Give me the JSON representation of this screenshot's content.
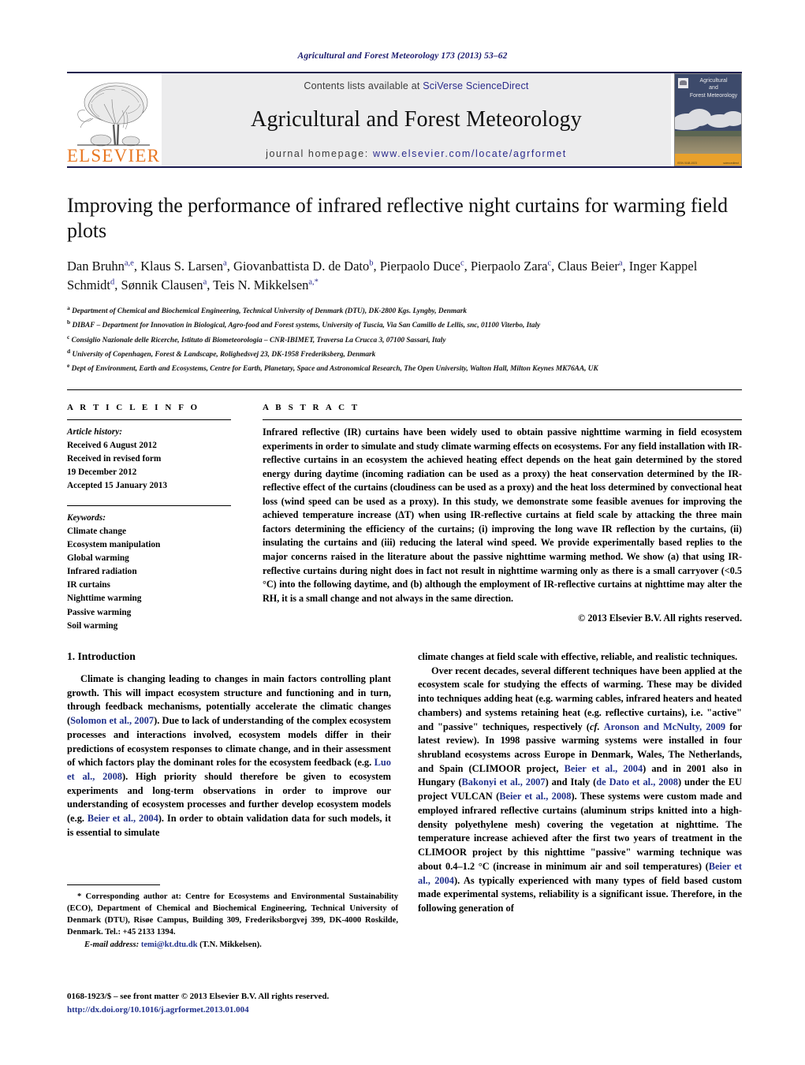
{
  "running_head": "Agricultural and Forest Meteorology 173 (2013) 53–62",
  "masthead": {
    "publisher_name": "ELSEVIER",
    "contents_prefix": "Contents lists available at ",
    "contents_link": "SciVerse ScienceDirect",
    "journal_title": "Agricultural and Forest Meteorology",
    "homepage_prefix": "journal homepage: ",
    "homepage_url": "www.elsevier.com/locate/agrformet",
    "cover_title": "Agricultural\nand\nForest Meteorology",
    "cover_bottom_left": "ISSN 0168-1923\nVol. 173",
    "cover_bottom_right": "Available online at\nwww.sciencedirect.com",
    "accent_orange": "#e87722",
    "link_blue": "#2a2a8c"
  },
  "article": {
    "title": "Improving the performance of infrared reflective night curtains for warming field plots",
    "authors_html": "Dan Bruhn<sup>a,e</sup>, Klaus S. Larsen<sup>a</sup>, Giovanbattista D. de Dato<sup>b</sup>, Pierpaolo Duce<sup>c</sup>, Pierpaolo Zara<sup>c</sup>, Claus Beier<sup>a</sup>, Inger Kappel Schmidt<sup>d</sup>, Sønnik Clausen<sup>a</sup>, Teis N. Mikkelsen<sup>a,*</sup>",
    "affiliations": [
      {
        "marker": "a",
        "text": "Department of Chemical and Biochemical Engineering, Technical University of Denmark (DTU), DK-2800 Kgs. Lyngby, Denmark"
      },
      {
        "marker": "b",
        "text": "DIBAF – Department for Innovation in Biological, Agro-food and Forest systems, University of Tuscia, Via San Camillo de Lellis, snc, 01100 Viterbo, Italy"
      },
      {
        "marker": "c",
        "text": "Consiglio Nazionale delle Ricerche, Istituto di Biometeorologia – CNR-IBIMET, Traversa La Crucca 3, 07100 Sassari, Italy"
      },
      {
        "marker": "d",
        "text": "University of Copenhagen, Forest & Landscape, Rolighedsvej 23, DK-1958 Frederiksberg, Denmark"
      },
      {
        "marker": "e",
        "text": "Dept of Environment, Earth and Ecosystems, Centre for Earth, Planetary, Space and Astronomical Research, The Open University, Walton Hall, Milton Keynes MK76AA, UK"
      }
    ]
  },
  "article_info": {
    "heading": "A R T I C L E   I N F O",
    "history_label": "Article history:",
    "history": [
      "Received 6 August 2012",
      "Received in revised form",
      "19 December 2012",
      "Accepted 15 January 2013"
    ],
    "keywords_label": "Keywords:",
    "keywords": [
      "Climate change",
      "Ecosystem manipulation",
      "Global warming",
      "Infrared radiation",
      "IR curtains",
      "Nighttime warming",
      "Passive warming",
      "Soil warming"
    ]
  },
  "abstract": {
    "heading": "A B S T R A C T",
    "text": "Infrared reflective (IR) curtains have been widely used to obtain passive nighttime warming in field ecosystem experiments in order to simulate and study climate warming effects on ecosystems. For any field installation with IR-reflective curtains in an ecosystem the achieved heating effect depends on the heat gain determined by the stored energy during daytime (incoming radiation can be used as a proxy) the heat conservation determined by the IR-reflective effect of the curtains (cloudiness can be used as a proxy) and the heat loss determined by convectional heat loss (wind speed can be used as a proxy). In this study, we demonstrate some feasible avenues for improving the achieved temperature increase (ΔT) when using IR-reflective curtains at field scale by attacking the three main factors determining the efficiency of the curtains; (i) improving the long wave IR reflection by the curtains, (ii) insulating the curtains and (iii) reducing the lateral wind speed. We provide experimentally based replies to the major concerns raised in the literature about the passive nighttime warming method. We show (a) that using IR-reflective curtains during night does in fact not result in nighttime warming only as there is a small carryover (<0.5 °C) into the following daytime, and (b) although the employment of IR-reflective curtains at nighttime may alter the RH, it is a small change and not always in the same direction.",
    "copyright": "© 2013 Elsevier B.V. All rights reserved."
  },
  "introduction": {
    "section_number_title": "1.  Introduction",
    "left_paragraph_1_parts": [
      {
        "t": "Climate is changing leading to changes in main factors controlling plant growth. This will impact ecosystem structure and functioning and in turn, through feedback mechanisms, potentially accelerate the climatic changes (",
        "c": false
      },
      {
        "t": "Solomon et al., 2007",
        "c": true
      },
      {
        "t": "). Due to lack of understanding of the complex ecosystem processes and interactions involved, ecosystem models differ in their predictions of ecosystem responses to climate change, and in their assessment of which factors play the dominant roles for the ecosystem feedback (e.g. ",
        "c": false
      },
      {
        "t": "Luo et al., 2008",
        "c": true
      },
      {
        "t": "). High priority should therefore be given to ecosystem experiments and long-term observations in order to improve our understanding of ecosystem processes and further develop ecosystem models (e.g. ",
        "c": false
      },
      {
        "t": "Beier et al., 2004",
        "c": true
      },
      {
        "t": "). In order to obtain validation data for such models, it is essential to simulate",
        "c": false
      }
    ],
    "right_continuation_parts": [
      {
        "t": "climate changes at field scale with effective, reliable, and realistic techniques.",
        "c": false
      }
    ],
    "right_paragraph_2_parts": [
      {
        "t": "Over recent decades, several different techniques have been applied at the ecosystem scale for studying the effects of warming. These may be divided into techniques adding heat (e.g. warming cables, infrared heaters and heated chambers) and systems retaining heat (e.g. reflective curtains), i.e. \"active\" and \"passive\" techniques, respectively (",
        "c": false
      },
      {
        "t": "cf. ",
        "c": false,
        "i": true
      },
      {
        "t": "Aronson and McNulty, 2009",
        "c": true
      },
      {
        "t": " for latest review). In 1998 passive warming systems were installed in four shrubland ecosystems across Europe in Denmark, Wales, The Netherlands, and Spain (CLIMOOR project, ",
        "c": false
      },
      {
        "t": "Beier et al., 2004",
        "c": true
      },
      {
        "t": ") and in 2001 also in Hungary (",
        "c": false
      },
      {
        "t": "Bakonyi et al., 2007",
        "c": true
      },
      {
        "t": ") and Italy (",
        "c": false
      },
      {
        "t": "de Dato et al., 2008",
        "c": true
      },
      {
        "t": ") under the EU project VULCAN (",
        "c": false
      },
      {
        "t": "Beier et al., 2008",
        "c": true
      },
      {
        "t": "). These systems were custom made and employed infrared reflective curtains (aluminum strips knitted into a high-density polyethylene mesh) covering the vegetation at nighttime. The temperature increase achieved after the first two years of treatment in the CLIMOOR project by this nighttime \"passive\" warming technique was about 0.4–1.2 °C (increase in minimum air and soil temperatures) (",
        "c": false
      },
      {
        "t": "Beier et al., 2004",
        "c": true
      },
      {
        "t": "). As typically experienced with many types of field based custom made experimental systems, reliability is a significant issue. Therefore, in the following generation of",
        "c": false
      }
    ]
  },
  "footnote": {
    "corresponding": "* Corresponding author at: Centre for Ecosystems and Environmental Sustainability (ECO), Department of Chemical and Biochemical Engineering, Technical University of Denmark (DTU), Risøe Campus, Building 309, Frederiksborgvej 399, DK-4000 Roskilde, Denmark. Tel.: +45 2133 1394.",
    "email_label": "E-mail address:",
    "email_address": "temi@kt.dtu.dk",
    "email_owner": "(T.N. Mikkelsen).",
    "issn_line": "0168-1923/$ – see front matter © 2013 Elsevier B.V. All rights reserved.",
    "doi": "http://dx.doi.org/10.1016/j.agrformet.2013.01.004"
  }
}
